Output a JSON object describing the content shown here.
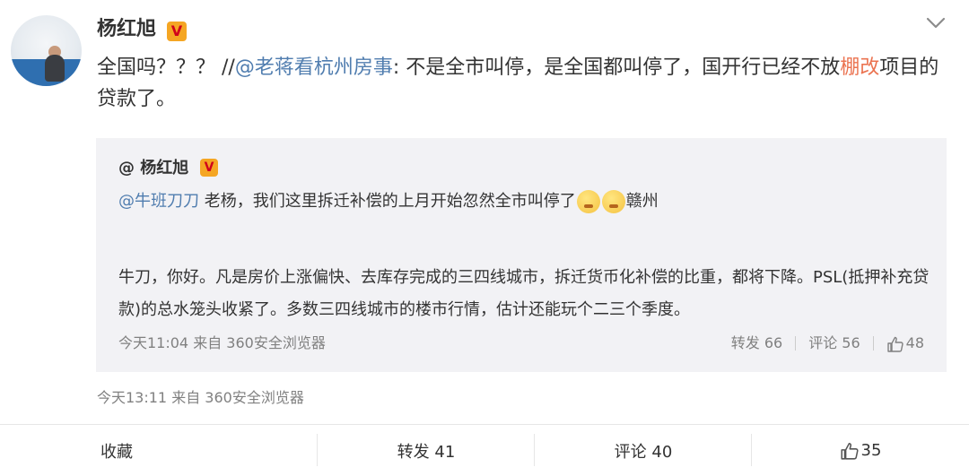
{
  "post": {
    "author": "杨红旭",
    "badge": "V",
    "text_prefix": "全国吗？？？ //",
    "mention": "@老蒋看杭州房事",
    "text_mid": ": 不是全市叫停，是全国都叫停了，国开行已经不放",
    "highlight": "棚改",
    "text_suffix": "项目的贷款了。",
    "time_source": "今天13:11 来自 360安全浏览器"
  },
  "repost": {
    "author": "@ 杨红旭",
    "badge": "V",
    "mention": "@牛班刀刀",
    "line1": " 老杨，我们这里拆迁补偿的上月开始忽然全市叫停了",
    "location": "赣州",
    "body": "牛刀，你好。凡是房价上涨偏快、去库存完成的三四线城市，拆迁货币化补偿的比重，都将下降。PSL(抵押补充贷款)的总水笼头收紧了。多数三四线城市的楼市行情，估计还能玩个二三个季度。",
    "time_source": "今天11:04 来自 360安全浏览器",
    "repost_count": "转发 66",
    "comment_count": "评论 56",
    "like_count": "48"
  },
  "actions": {
    "favorite": "收藏",
    "repost": "转发 41",
    "comment": "评论 40",
    "like": "35"
  },
  "colors": {
    "link": "#507daf",
    "highlight": "#eb7350",
    "badge_bg": "#f5a623",
    "badge_fg": "#d0021b",
    "repost_bg": "#f2f2f5"
  }
}
